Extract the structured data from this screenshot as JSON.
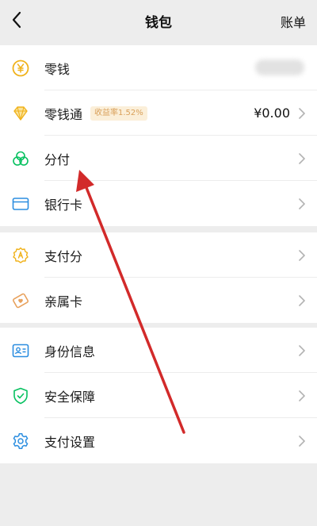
{
  "header": {
    "title": "钱包",
    "bill_label": "账单"
  },
  "group1": {
    "change_label": "零钱",
    "wealth_label": "零钱通",
    "wealth_badge": "收益率1.52%",
    "wealth_value": "¥0.00",
    "installment_label": "分付",
    "bank_card_label": "银行卡"
  },
  "group2": {
    "pay_score_label": "支付分",
    "family_card_label": "亲属卡"
  },
  "group3": {
    "identity_label": "身份信息",
    "security_label": "安全保障",
    "pay_settings_label": "支付设置"
  },
  "colors": {
    "accent_green": "#07c160",
    "accent_gold": "#f0b21b",
    "arrow_red": "#d22a2a"
  }
}
